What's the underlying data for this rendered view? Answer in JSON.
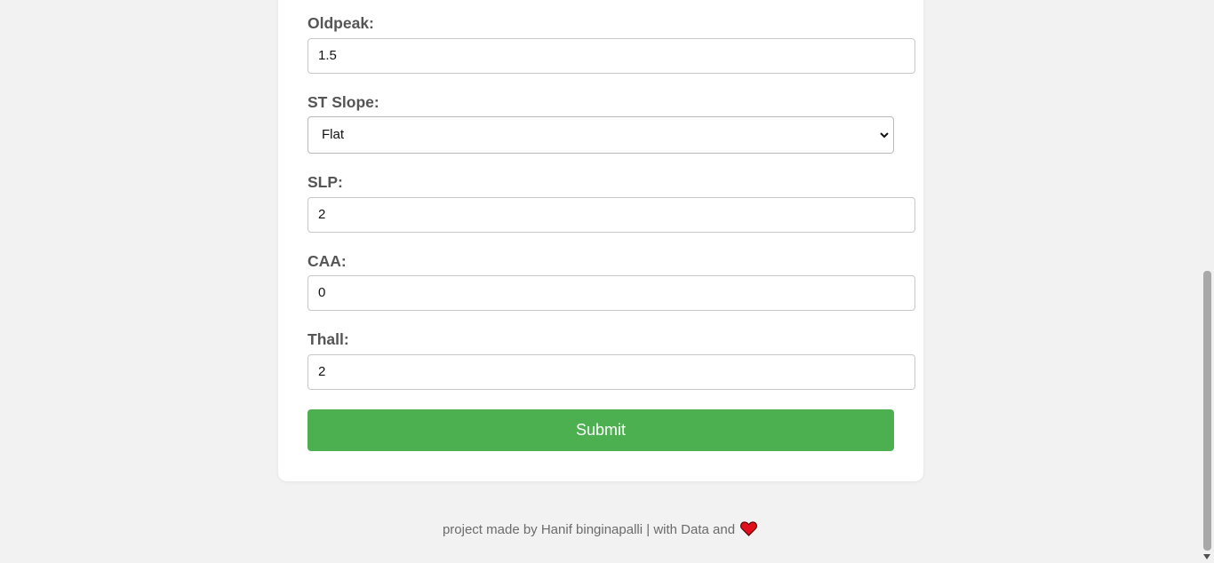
{
  "form": {
    "oldpeak": {
      "label": "Oldpeak:",
      "value": "1.5"
    },
    "st_slope": {
      "label": "ST Slope:",
      "selected": "Flat"
    },
    "slp": {
      "label": "SLP:",
      "value": "2"
    },
    "caa": {
      "label": "CAA:",
      "value": "0"
    },
    "thall": {
      "label": "Thall:",
      "value": "2"
    },
    "submit_label": "Submit"
  },
  "footer": {
    "text": "project made by Hanif binginapalli | with Data and",
    "icon": "heart-icon"
  },
  "colors": {
    "submit": "#4caf50",
    "heart": "#e0101a",
    "background": "#f2f2f2"
  }
}
